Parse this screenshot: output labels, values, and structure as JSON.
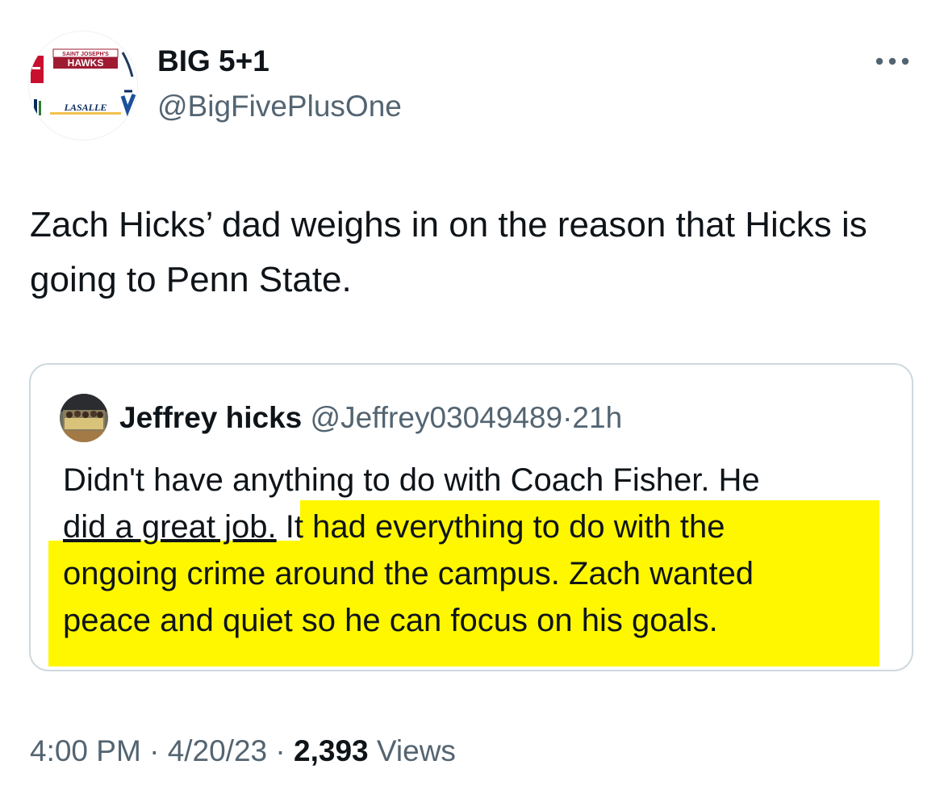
{
  "author": {
    "display_name": "BIG 5+1",
    "handle": "@BigFivePlusOne",
    "avatar_logo_text_top": "SAINT JOSEPH'S",
    "avatar_logo_text_main": "HAWKS",
    "avatar_logo_text_bottom": "LASALLE"
  },
  "tweet": {
    "text": "Zach Hicks’ dad weighs in on the reason that Hicks is going to Penn State."
  },
  "quote": {
    "display_name": "Jeffrey hicks",
    "handle": "@Jeffrey03049489",
    "separator": "·",
    "time": "21h",
    "line1": "Didn't have anything to do with Coach Fisher. He",
    "line2_plain": "did a great job.",
    "line2_highlight": " It had everything to do with the",
    "line3": "ongoing crime around the campus. Zach wanted",
    "line4": "peace and quiet so he can focus on his goals."
  },
  "meta": {
    "time": "4:00 PM",
    "separator": "·",
    "date": "4/20/23",
    "views_count": "2,393",
    "views_label": "Views"
  },
  "colors": {
    "text_primary": "#0f1419",
    "text_secondary": "#536471",
    "border": "#cfd9de",
    "highlight": "#fff700"
  },
  "icons": {
    "more": "more-horizontal-icon"
  }
}
